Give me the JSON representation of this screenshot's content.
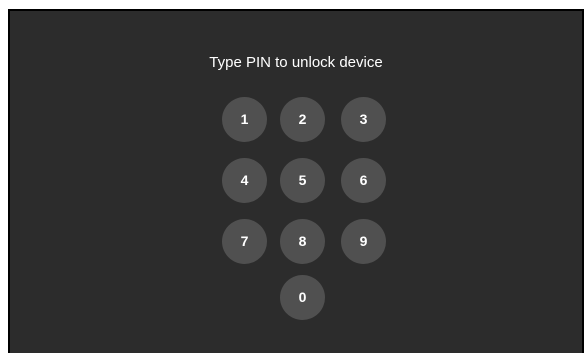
{
  "lock_screen": {
    "prompt": "Type PIN to unlock device",
    "keys": [
      "1",
      "2",
      "3",
      "4",
      "5",
      "6",
      "7",
      "8",
      "9",
      "0"
    ]
  },
  "colors": {
    "background": "#2c2c2c",
    "key_fill": "#505050",
    "text": "#ffffff"
  }
}
